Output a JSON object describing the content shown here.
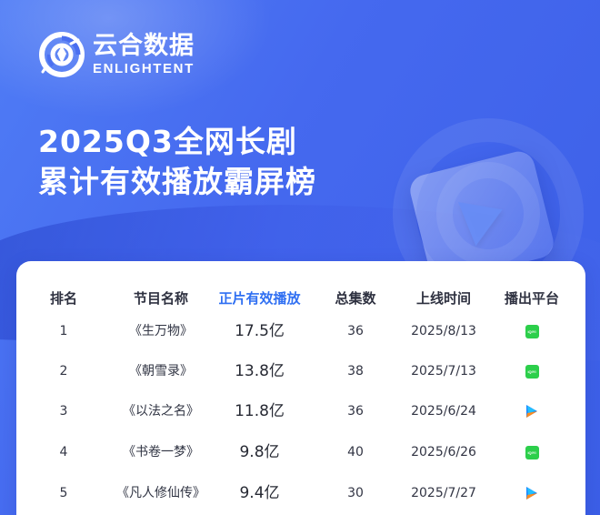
{
  "brand": {
    "cn": "云合数据",
    "en": "ENLIGHTENT"
  },
  "headline": {
    "line1": "2025Q3全网长剧",
    "line2": "累计有效播放霸屏榜"
  },
  "table": {
    "headers": [
      "排名",
      "节目名称",
      "正片有效播放",
      "总集数",
      "上线时间",
      "播出平台"
    ],
    "rows": [
      {
        "rank": "1",
        "title": "《生万物》",
        "plays": "17.5亿",
        "episodes": "36",
        "date": "2025/8/13",
        "platform_icon": "iqiyi-icon",
        "platform_label": "iQIYI"
      },
      {
        "rank": "2",
        "title": "《朝雪录》",
        "plays": "13.8亿",
        "episodes": "38",
        "date": "2025/7/13",
        "platform_icon": "iqiyi-icon",
        "platform_label": "iQIYI"
      },
      {
        "rank": "3",
        "title": "《以法之名》",
        "plays": "11.8亿",
        "episodes": "36",
        "date": "2025/6/24",
        "platform_icon": "tencent-video-icon",
        "platform_label": ""
      },
      {
        "rank": "4",
        "title": "《书卷一梦》",
        "plays": "9.8亿",
        "episodes": "40",
        "date": "2025/6/26",
        "platform_icon": "iqiyi-icon",
        "platform_label": "iQIYI"
      },
      {
        "rank": "5",
        "title": "《凡人修仙传》",
        "plays": "9.4亿",
        "episodes": "30",
        "date": "2025/7/27",
        "platform_icon": "tencent-video-icon",
        "platform_label": ""
      }
    ]
  },
  "colors": {
    "background": "#4569ef",
    "highlight": "#2f6ff2",
    "iqiyi_green": "#2ccf4b",
    "tencent_blue": "#1e88ff",
    "tencent_orange": "#ff8b1f"
  }
}
